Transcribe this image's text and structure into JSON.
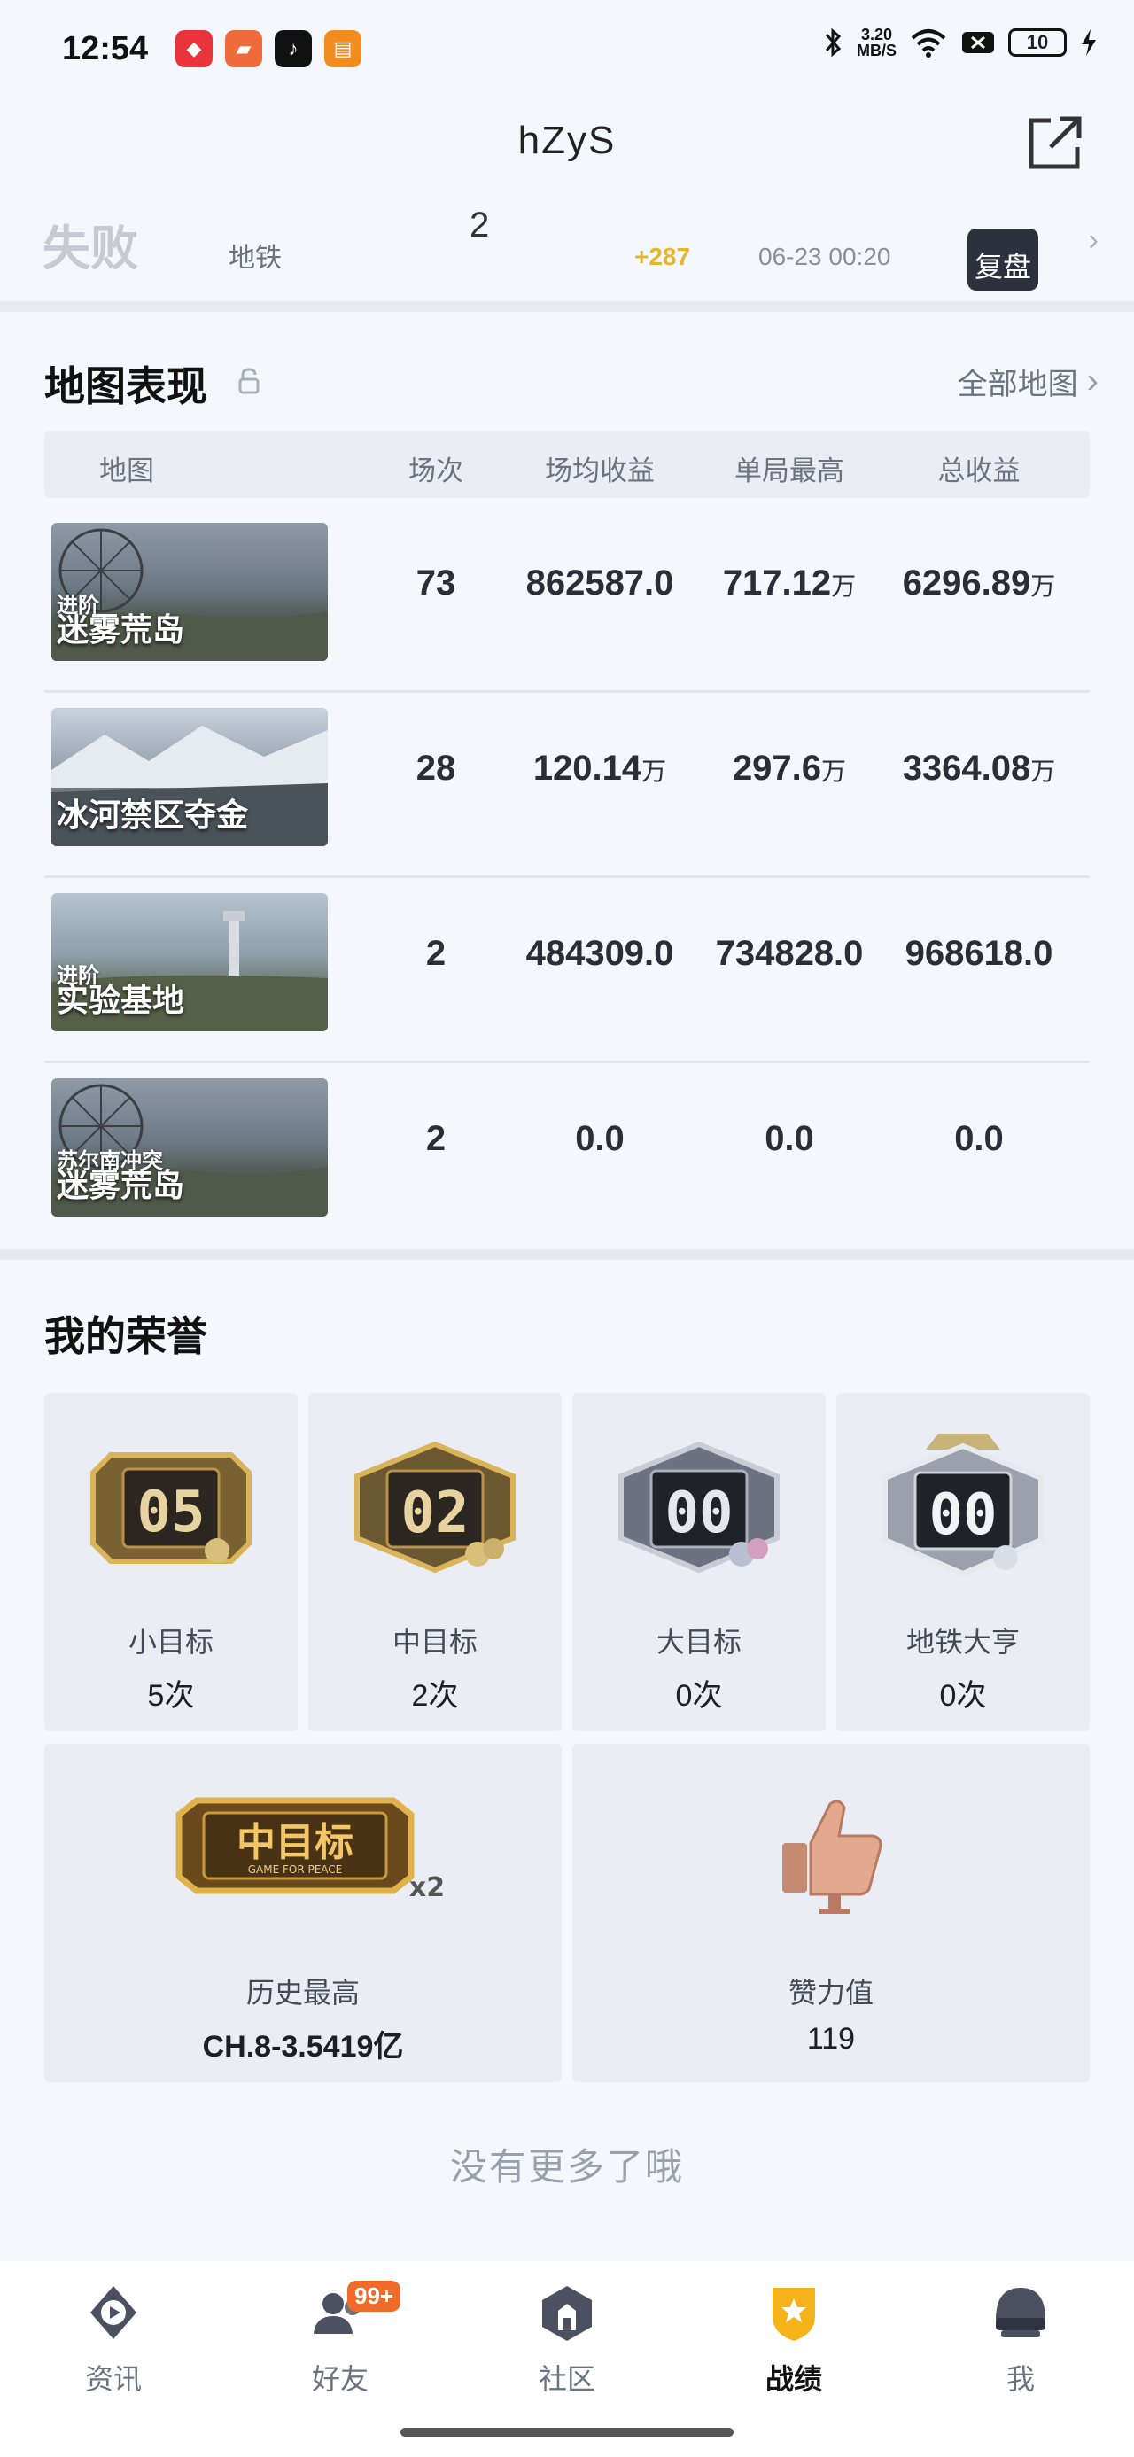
{
  "status_bar": {
    "time": "12:54",
    "net_speed_value": "3.20",
    "net_speed_unit": "MB/S",
    "battery": "10"
  },
  "header": {
    "title": "hZyS"
  },
  "match_row": {
    "result": "失败",
    "mode": "地铁",
    "kills": "2",
    "gain": "+287",
    "time": "06-23 00:20",
    "replay_label": "复盘"
  },
  "map_section": {
    "title": "地图表现",
    "all_maps_label": "全部地图",
    "columns": [
      "地图",
      "场次",
      "场均收益",
      "单局最高",
      "总收益"
    ],
    "rows": [
      {
        "sub": "进阶",
        "name": "迷雾荒岛",
        "matches": "73",
        "avg": "862587.0",
        "avg_unit": "",
        "best": "717.12",
        "best_unit": "万",
        "total": "6296.89",
        "total_unit": "万"
      },
      {
        "sub": "",
        "name": "冰河禁区夺金",
        "matches": "28",
        "avg": "120.14",
        "avg_unit": "万",
        "best": "297.6",
        "best_unit": "万",
        "total": "3364.08",
        "total_unit": "万"
      },
      {
        "sub": "进阶",
        "name": "实验基地",
        "matches": "2",
        "avg": "484309.0",
        "avg_unit": "",
        "best": "734828.0",
        "best_unit": "",
        "total": "968618.0",
        "total_unit": ""
      },
      {
        "sub": "苏尔南冲突",
        "name": "迷雾荒岛",
        "matches": "2",
        "avg": "0.0",
        "avg_unit": "",
        "best": "0.0",
        "best_unit": "",
        "total": "0.0",
        "total_unit": ""
      }
    ]
  },
  "honor_section": {
    "title": "我的荣誉",
    "small_cards": [
      {
        "badge_num": "05",
        "label": "小目标",
        "value": "5次"
      },
      {
        "badge_num": "02",
        "label": "中目标",
        "value": "2次"
      },
      {
        "badge_num": "00",
        "label": "大目标",
        "value": "0次"
      },
      {
        "badge_num": "00",
        "label": "地铁大亨",
        "value": "0次"
      }
    ],
    "history": {
      "badge_text": "中目标",
      "badge_sub": "GAME FOR PEACE",
      "multiplier": "x2",
      "label": "历史最高",
      "value": "CH.8-3.5419亿"
    },
    "likes": {
      "label": "赞力值",
      "value": "119"
    },
    "no_more": "没有更多了哦"
  },
  "bottom_nav": {
    "items": [
      {
        "label": "资讯"
      },
      {
        "label": "好友",
        "badge": "99+"
      },
      {
        "label": "社区"
      },
      {
        "label": "战绩"
      },
      {
        "label": "我"
      }
    ]
  },
  "colors": {
    "accent_gold": "#e7b52d",
    "nav_active": "#f5b21a",
    "badge_orange": "#f06a2a"
  }
}
